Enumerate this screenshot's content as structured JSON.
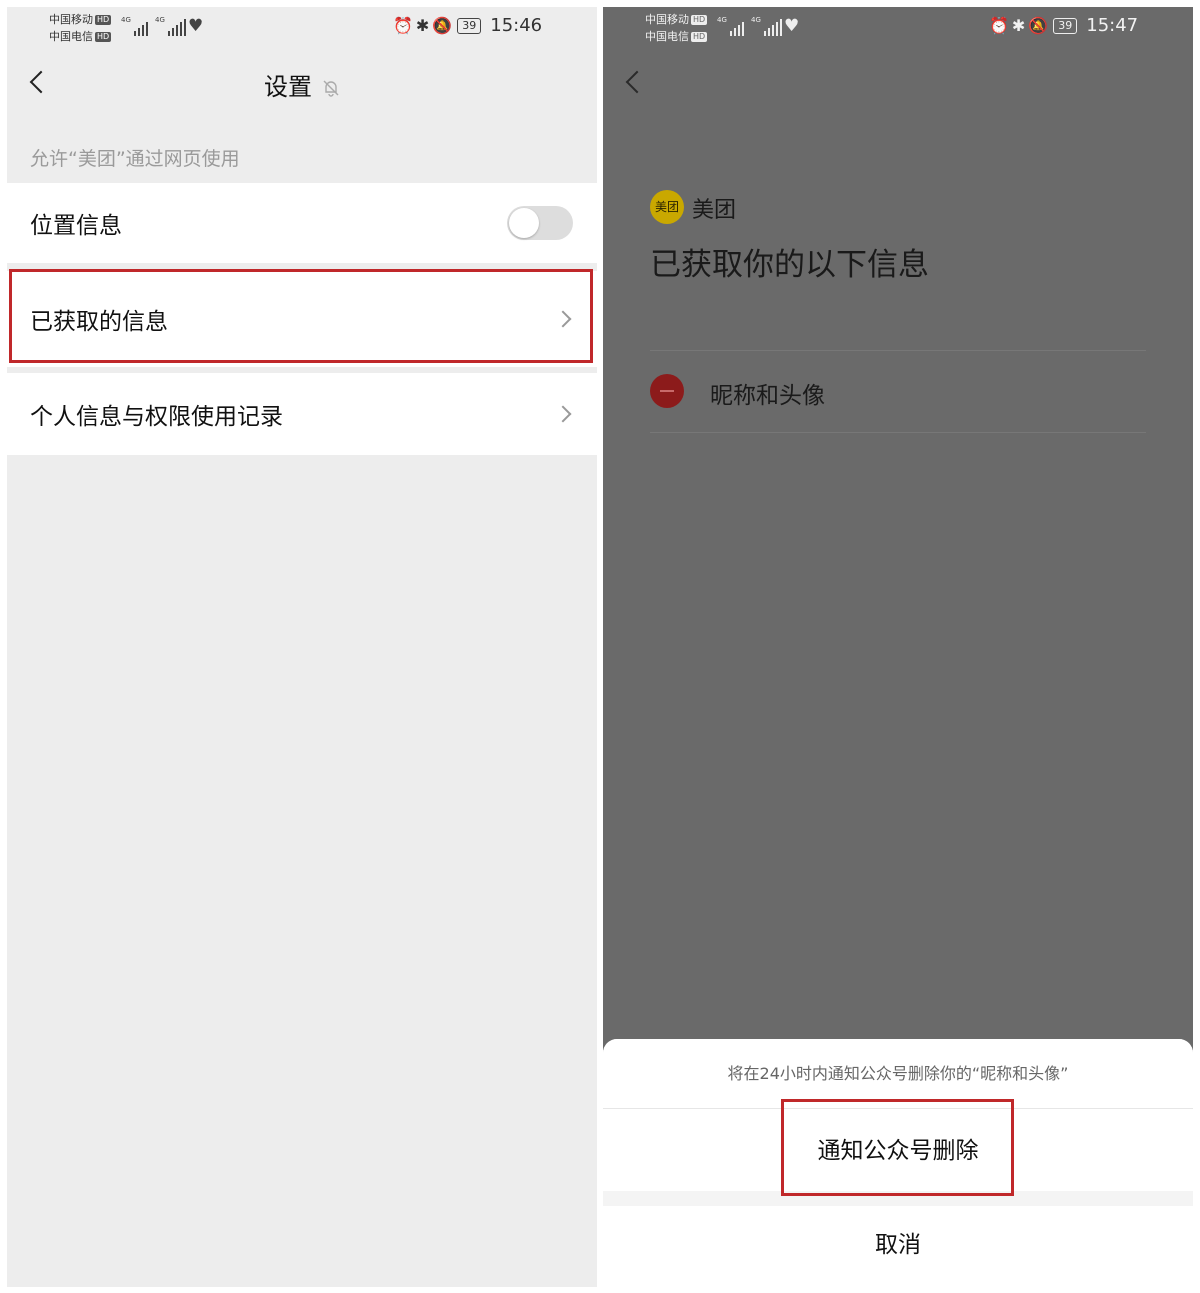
{
  "colors": {
    "highlight": "#c0282a",
    "overlay": "#6a6a6a",
    "brand_logo": "#c9a800",
    "remove": "#8c1b1b"
  },
  "left_screen": {
    "status_bar": {
      "carrier1": "中国移动",
      "carrier2": "中国电信",
      "hd": "HD",
      "network": "4G",
      "battery": "39",
      "time": "15:46",
      "icons": [
        "alarm-icon",
        "bluetooth-icon",
        "vibrate-icon",
        "mute-icon",
        "battery-icon",
        "signal-icon",
        "heart-icon"
      ]
    },
    "header": {
      "title": "设置",
      "title_icon": "mute-bell-icon"
    },
    "section_caption": "允许“美团”通过网页使用",
    "rows": {
      "location": {
        "label": "位置信息",
        "toggle_on": false
      },
      "obtained_info": {
        "label": "已获取的信息"
      },
      "usage_records": {
        "label": "个人信息与权限使用记录"
      }
    }
  },
  "right_screen": {
    "status_bar": {
      "carrier1": "中国移动",
      "carrier2": "中国电信",
      "hd": "HD",
      "network": "4G",
      "battery": "39",
      "time": "15:47"
    },
    "app": {
      "logo_text": "美团",
      "name": "美团"
    },
    "title": "已获取你的以下信息",
    "permission_item": {
      "label": "昵称和头像"
    },
    "sheet": {
      "message": "将在24小时内通知公众号删除你的“昵称和头像”",
      "action_label": "通知公众号删除",
      "cancel_label": "取消"
    }
  }
}
